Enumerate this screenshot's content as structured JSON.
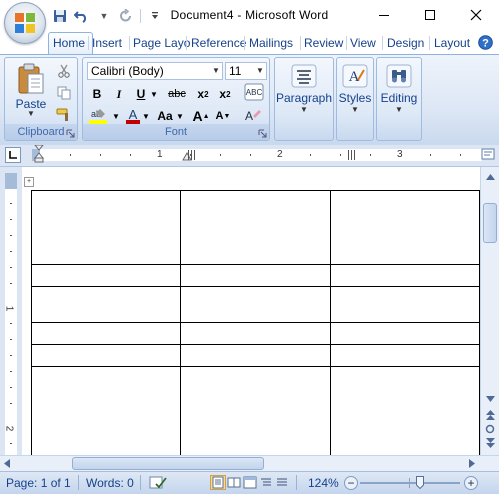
{
  "window": {
    "title": "Document4 - Microsoft Word"
  },
  "tabs": [
    "Home",
    "Insert",
    "Page Layo",
    "Reference",
    "Mailings",
    "Review",
    "View",
    "Design",
    "Layout"
  ],
  "ribbon": {
    "clipboard": {
      "paste_label": "Paste",
      "group_label": "Clipboard"
    },
    "font": {
      "font_name": "Calibri (Body)",
      "font_size": "11",
      "group_label": "Font"
    },
    "paragraph": {
      "label": "Paragraph"
    },
    "styles": {
      "label": "Styles"
    },
    "editing": {
      "label": "Editing"
    }
  },
  "ruler": {
    "numbers": [
      "1",
      "2",
      "3"
    ]
  },
  "vruler": {
    "numbers": [
      "1",
      "2"
    ]
  },
  "status": {
    "page": "Page: 1 of 1",
    "words": "Words: 0",
    "zoom": "124%",
    "zoom_fraction": 0.6
  },
  "colors": {
    "accent": "#15428b",
    "ribbon_bg": "#dde7f5",
    "highlight": "#ffff00",
    "font_color": "#c00000"
  }
}
